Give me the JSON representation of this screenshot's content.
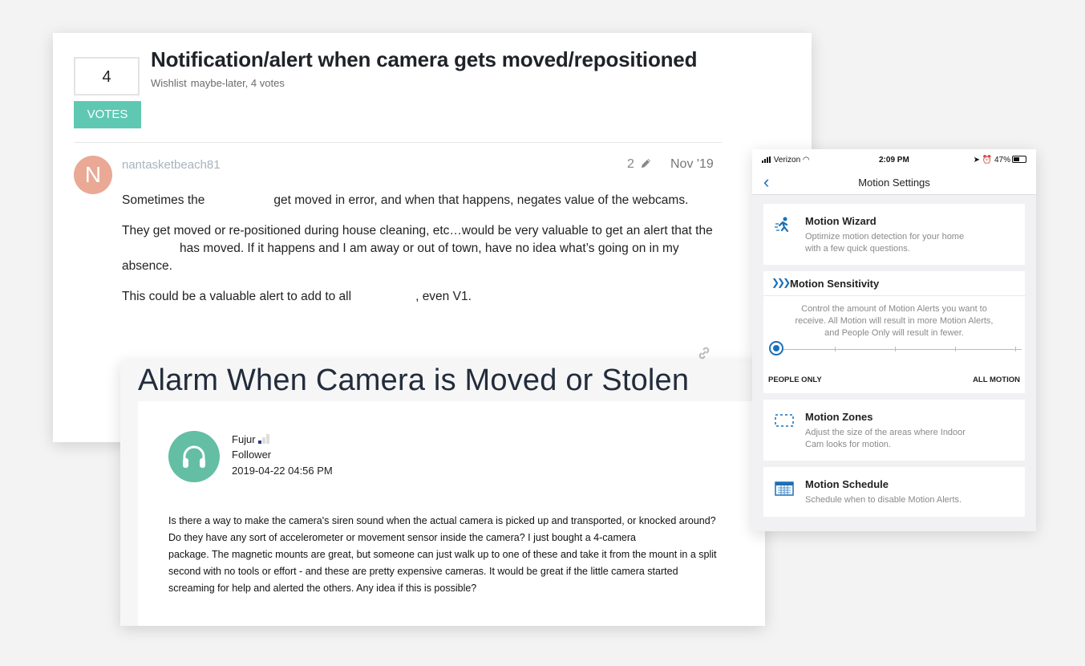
{
  "forum_post": {
    "vote_count": "4",
    "votes_label": "VOTES",
    "title": "Notification/alert when camera gets moved/repositioned",
    "category": "Wishlist",
    "status": "maybe-later",
    "votes_text": ", 4 votes",
    "avatar_letter": "N",
    "username": "nantasketbeach81",
    "edit_count": "2",
    "date": "Nov '19",
    "paragraphs": [
      {
        "a": "Sometimes the",
        "b": "get moved in error, and when that happens, negates value of the webcams."
      },
      {
        "a": "They get moved or re-positioned during house cleaning, etc…would be very valuable to get an alert that the",
        "b": "has moved. If it happens and I am away or out of town, have no idea what’s going on in my absence."
      },
      {
        "a": "This could be a valuable alert to add to all",
        "b": ", even V1."
      }
    ]
  },
  "community_post": {
    "title": "Alarm When Camera is Moved or Stolen",
    "author": "Fujur",
    "role": "Follower",
    "datetime": "2019-04-22 04:56 PM",
    "body": [
      "Is there a way to make the camera's siren sound when the actual camera is picked up and transported, or knocked around?",
      "Do they have any sort of accelerometer or movement sensor inside the camera? I just bought a 4-camera",
      "package. The magnetic mounts are great, but someone can just walk up to one of these and take it from the mount in a split",
      "second with no tools or effort - and these are pretty expensive cameras. It would be great if the little camera started",
      "screaming for help and alerted the others. Any idea if this is possible?"
    ]
  },
  "phone": {
    "carrier": "Verizon",
    "time": "2:09 PM",
    "battery": "47%",
    "screen_title": "Motion Settings",
    "accent": "#1a6fb8",
    "motion_wizard": {
      "title": "Motion Wizard",
      "desc1": "Optimize motion detection for your home",
      "desc2": "with a few quick questions."
    },
    "motion_sensitivity": {
      "title": "Motion Sensitivity",
      "desc1": "Control the amount of Motion Alerts you want to",
      "desc2": "receive. All Motion will result in more Motion Alerts,",
      "desc3": "and People Only will result in fewer.",
      "left_label": "PEOPLE ONLY",
      "right_label": "ALL MOTION",
      "level": 0
    },
    "motion_zones": {
      "title": "Motion Zones",
      "desc1": "Adjust the size of the areas where Indoor",
      "desc2": "Cam looks for motion."
    },
    "motion_schedule": {
      "title": "Motion Schedule",
      "desc1": "Schedule when to disable Motion Alerts."
    }
  }
}
